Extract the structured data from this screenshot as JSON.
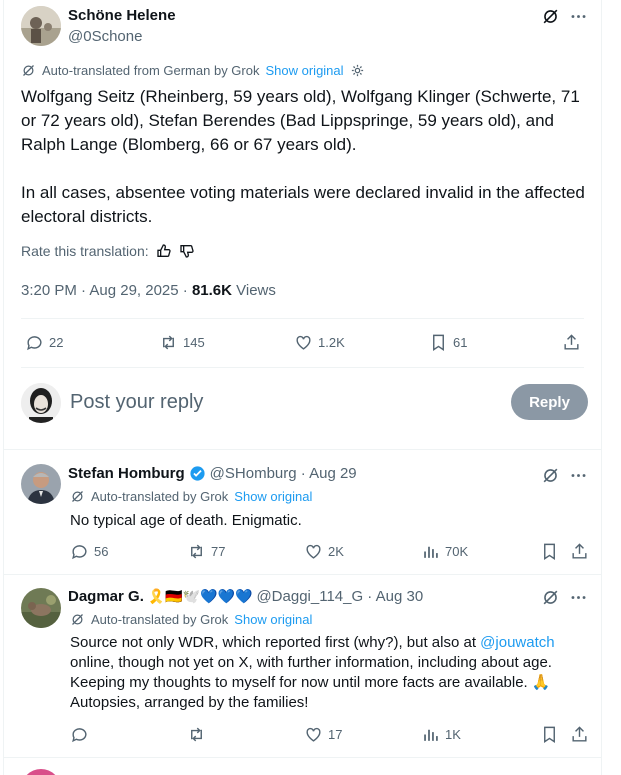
{
  "main_post": {
    "author_name": "Schöne Helene",
    "handle": "@0Schone",
    "translation_note": "Auto-translated from German by Grok",
    "show_original": "Show original",
    "paragraph_1": "Wolfgang Seitz (Rheinberg, 59 years old), Wolfgang Klinger (Schwerte, 71 or 72 years old), Stefan Berendes (Bad Lippspringe, 59 years old), and Ralph Lange (Blomberg, 66 or 67 years old).",
    "paragraph_2": "In all cases, absentee voting materials were declared invalid in the affected electoral districts.",
    "rate_translation": "Rate this translation:",
    "timestamp": "3:20 PM · Aug 29, 2025 · ",
    "views_count": "81.6K",
    "views_label": " Views",
    "stats": {
      "replies": "22",
      "reposts": "145",
      "likes": "1.2K",
      "bookmarks": "61"
    }
  },
  "composer": {
    "placeholder": "Post your reply",
    "reply_button": "Reply"
  },
  "replies": [
    {
      "author_name": "Stefan Homburg",
      "handle_time": "@SHomburg · Aug 29",
      "translation_note": "Auto-translated by Grok",
      "show_original": "Show original",
      "text": "No typical age of death. Enigmatic.",
      "replies": "56",
      "reposts": "77",
      "likes": "2K",
      "views": "70K"
    },
    {
      "author_name": "Dagmar G.",
      "name_emojis": "🎗️🇩🇪🕊️💙💙💙",
      "handle_time": "@Daggi_114_G · Aug 30",
      "translation_note": "Auto-translated by Grok",
      "show_original": "Show original",
      "text_before_mention": "Source not only WDR, which reported first (why?), but also at ",
      "mention": "@jouwatch",
      "text_after_mention": " online, though not yet on X, with further information, including about age. Keeping my thoughts to myself for now until more facts are available. 🙏 Autopsies, arranged by the families!",
      "replies": "",
      "reposts": "",
      "likes": "17",
      "views": "1K"
    }
  ],
  "colors": {
    "accent": "#1d9bf0",
    "muted": "#536471",
    "text": "#0f1419",
    "reply_button_bg": "#8b98a5",
    "divider": "#eff3f4"
  }
}
